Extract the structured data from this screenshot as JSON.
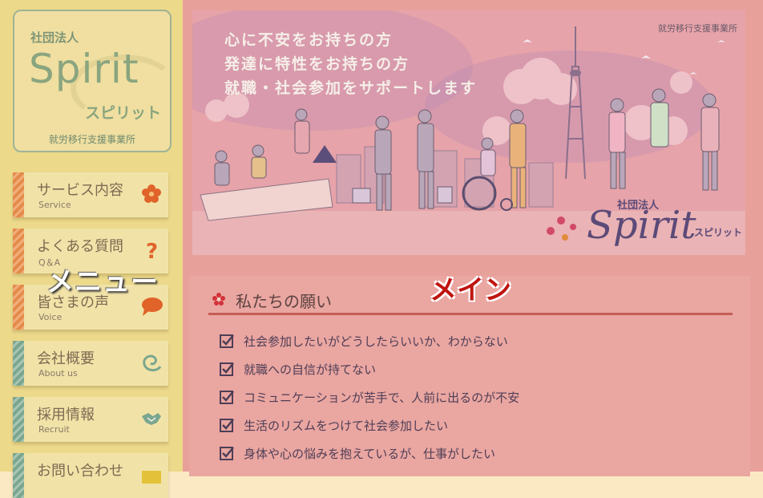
{
  "sidebar": {
    "logo": {
      "corp_label": "社団法人",
      "wordmark": "Spirit",
      "kana": "スピリット",
      "subtitle": "就労移行支援事業所"
    },
    "items": [
      {
        "label": "サービス内容",
        "sub": "Service",
        "icon": "flower-icon",
        "stripe": "orange"
      },
      {
        "label": "よくある質問",
        "sub": "Q＆A",
        "icon": "question-icon",
        "stripe": "orange"
      },
      {
        "label": "皆さまの声",
        "sub": "Voice",
        "icon": "speech-bubble-icon",
        "stripe": "orange"
      },
      {
        "label": "会社概要",
        "sub": "About us",
        "icon": "swirl-icon",
        "stripe": "green"
      },
      {
        "label": "採用情報",
        "sub": "Recruit",
        "icon": "handshake-icon",
        "stripe": "green"
      },
      {
        "label": "お問い合わせ",
        "sub": "",
        "icon": "mail-icon",
        "stripe": "green"
      }
    ],
    "overlay_label": "メニュー"
  },
  "main": {
    "overlay_label": "メイン",
    "banner": {
      "captions": [
        "心に不安をお持ちの方",
        "発達に特性をお持ちの方",
        "就職・社会参加をサポートします"
      ],
      "office": "就労移行支援事業所",
      "brand_corp": "社団法人",
      "brand_word": "Spirit",
      "brand_kana": "スピリット"
    },
    "section_title": "私たちの願い",
    "wishes": [
      "社会参加したいがどうしたらいいか、わからない",
      "就職への自信が持てない",
      "コミュニケーションが苦手で、人前に出るのが不安",
      "生活のリズムをつけて社会参加したい",
      "身体や心の悩みを抱えているが、仕事がしたい"
    ]
  },
  "colors": {
    "sidebar_overlay": "#ecd98a",
    "main_overlay": "#e8a09b",
    "stripe_orange": "#e58a4c",
    "stripe_green": "#7aa68f",
    "heading_rule": "#c55c55"
  }
}
